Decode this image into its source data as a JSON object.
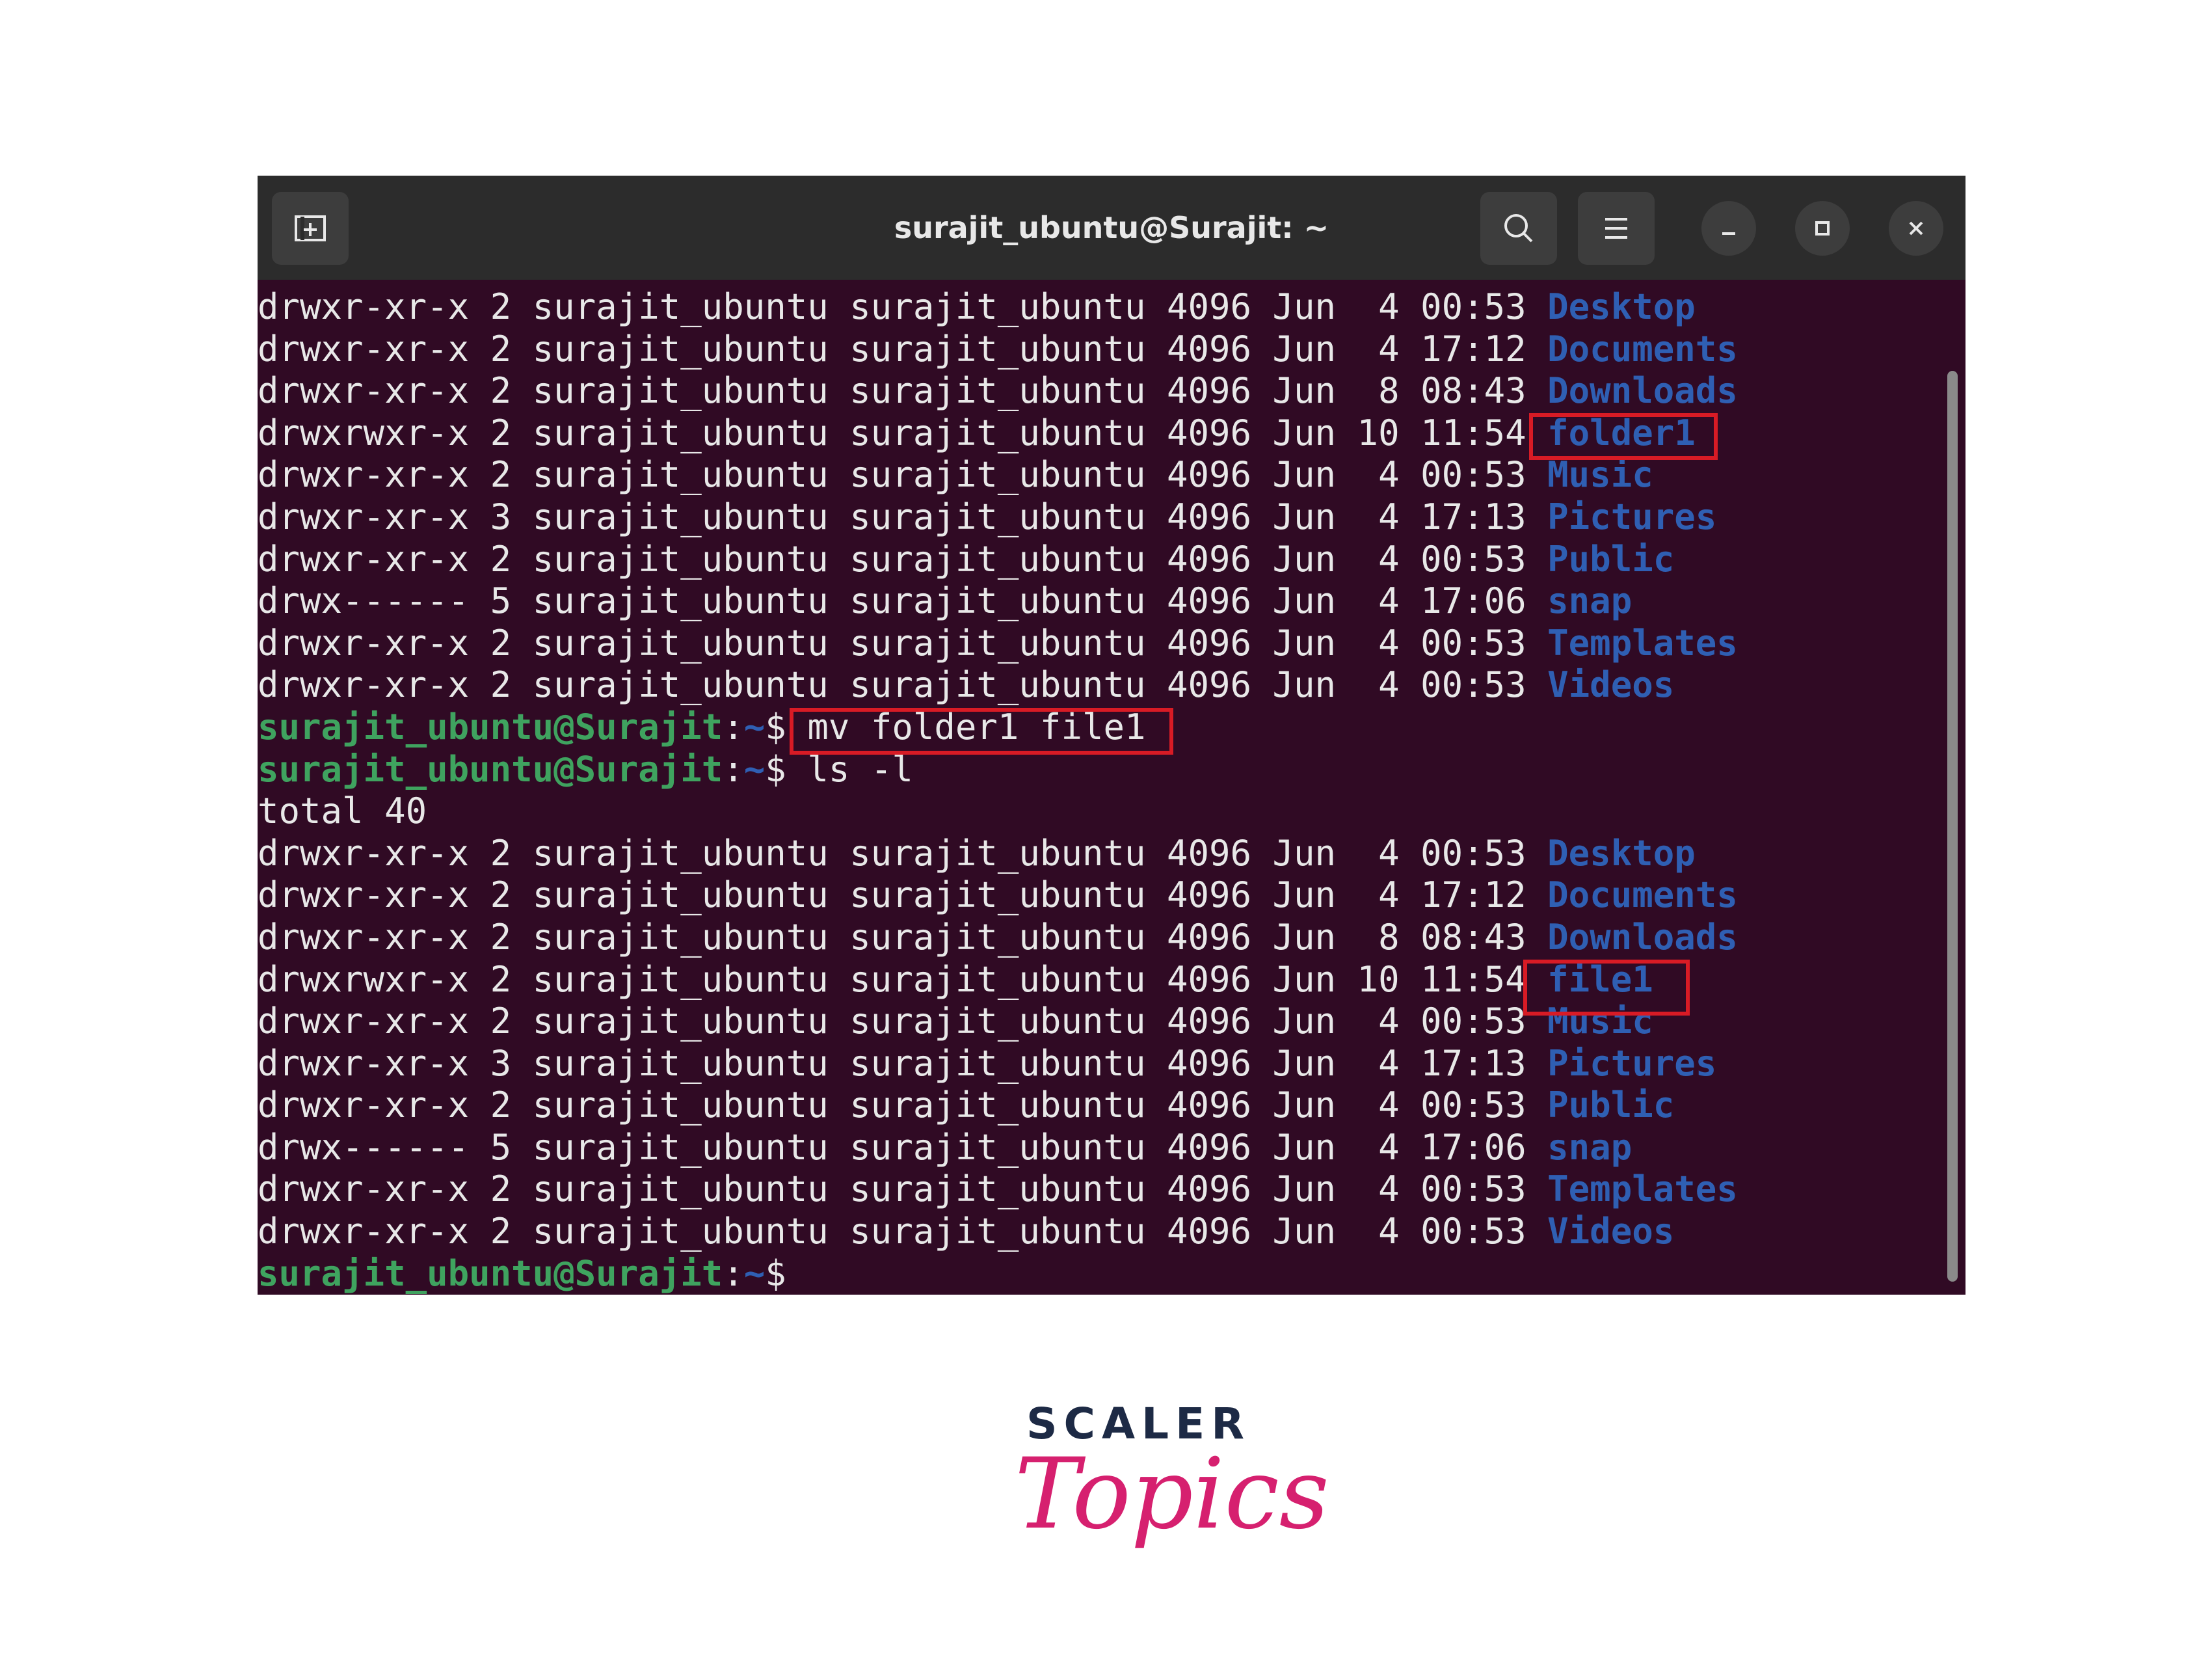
{
  "window": {
    "title": "surajit_ubuntu@Surajit: ~"
  },
  "colors": {
    "terminal_bg": "#300a24",
    "titlebar_bg": "#2c2c2c",
    "directory": "#2f5fb3",
    "prompt_user": "#3fa35f",
    "highlight_box": "#d81b25",
    "logo_dark": "#1d2a45",
    "logo_pink": "#d6206f"
  },
  "icons": {
    "new_tab": "new-tab-icon",
    "search": "search-icon",
    "menu": "hamburger-menu-icon",
    "minimize": "minimize-icon",
    "maximize": "maximize-icon",
    "close": "close-icon"
  },
  "prompt": {
    "user_host": "surajit_ubuntu@Surajit",
    "colon": ":",
    "path": "~",
    "symbol": "$"
  },
  "listing1": [
    {
      "meta": "drwxr-xr-x 2 surajit_ubuntu surajit_ubuntu 4096 Jun  4 00:53 ",
      "name": "Desktop"
    },
    {
      "meta": "drwxr-xr-x 2 surajit_ubuntu surajit_ubuntu 4096 Jun  4 17:12 ",
      "name": "Documents"
    },
    {
      "meta": "drwxr-xr-x 2 surajit_ubuntu surajit_ubuntu 4096 Jun  8 08:43 ",
      "name": "Downloads"
    },
    {
      "meta": "drwxrwxr-x 2 surajit_ubuntu surajit_ubuntu 4096 Jun 10 11:54 ",
      "name": "folder1"
    },
    {
      "meta": "drwxr-xr-x 2 surajit_ubuntu surajit_ubuntu 4096 Jun  4 00:53 ",
      "name": "Music"
    },
    {
      "meta": "drwxr-xr-x 3 surajit_ubuntu surajit_ubuntu 4096 Jun  4 17:13 ",
      "name": "Pictures"
    },
    {
      "meta": "drwxr-xr-x 2 surajit_ubuntu surajit_ubuntu 4096 Jun  4 00:53 ",
      "name": "Public"
    },
    {
      "meta": "drwx------ 5 surajit_ubuntu surajit_ubuntu 4096 Jun  4 17:06 ",
      "name": "snap"
    },
    {
      "meta": "drwxr-xr-x 2 surajit_ubuntu surajit_ubuntu 4096 Jun  4 00:53 ",
      "name": "Templates"
    },
    {
      "meta": "drwxr-xr-x 2 surajit_ubuntu surajit_ubuntu 4096 Jun  4 00:53 ",
      "name": "Videos"
    }
  ],
  "commands": {
    "mv": "mv folder1 file1",
    "ls": "ls -l",
    "total": "total 40"
  },
  "listing2": [
    {
      "meta": "drwxr-xr-x 2 surajit_ubuntu surajit_ubuntu 4096 Jun  4 00:53 ",
      "name": "Desktop"
    },
    {
      "meta": "drwxr-xr-x 2 surajit_ubuntu surajit_ubuntu 4096 Jun  4 17:12 ",
      "name": "Documents"
    },
    {
      "meta": "drwxr-xr-x 2 surajit_ubuntu surajit_ubuntu 4096 Jun  8 08:43 ",
      "name": "Downloads"
    },
    {
      "meta": "drwxrwxr-x 2 surajit_ubuntu surajit_ubuntu 4096 Jun 10 11:54 ",
      "name": "file1"
    },
    {
      "meta": "drwxr-xr-x 2 surajit_ubuntu surajit_ubuntu 4096 Jun  4 00:53 ",
      "name": "Music"
    },
    {
      "meta": "drwxr-xr-x 3 surajit_ubuntu surajit_ubuntu 4096 Jun  4 17:13 ",
      "name": "Pictures"
    },
    {
      "meta": "drwxr-xr-x 2 surajit_ubuntu surajit_ubuntu 4096 Jun  4 00:53 ",
      "name": "Public"
    },
    {
      "meta": "drwx------ 5 surajit_ubuntu surajit_ubuntu 4096 Jun  4 17:06 ",
      "name": "snap"
    },
    {
      "meta": "drwxr-xr-x 2 surajit_ubuntu surajit_ubuntu 4096 Jun  4 00:53 ",
      "name": "Templates"
    },
    {
      "meta": "drwxr-xr-x 2 surajit_ubuntu surajit_ubuntu 4096 Jun  4 00:53 ",
      "name": "Videos"
    }
  ],
  "logo": {
    "line1": "SCALER",
    "line2": "Topics"
  }
}
